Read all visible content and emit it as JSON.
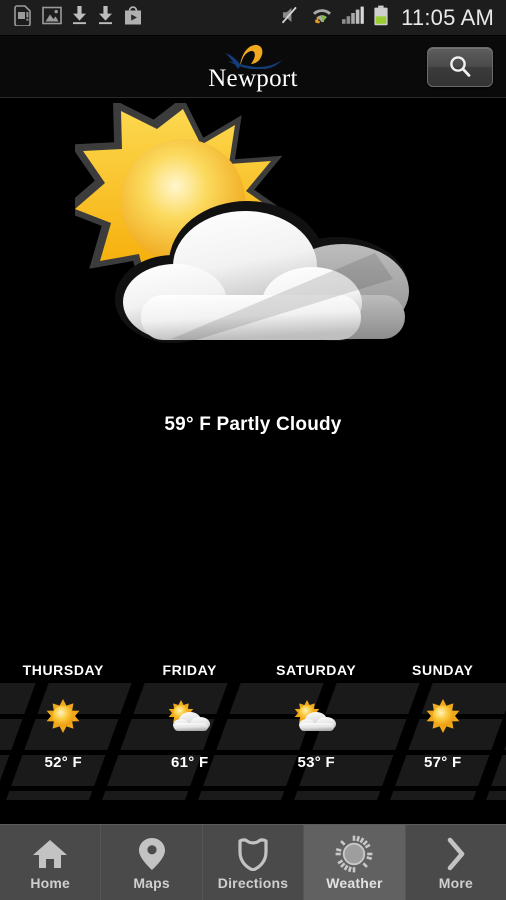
{
  "statusbar": {
    "time": "11:05 AM",
    "left_icons": [
      {
        "name": "sim-card-alert-icon",
        "label": "SIM card alert"
      },
      {
        "name": "image-icon",
        "label": "Screenshot captured"
      },
      {
        "name": "download-icon",
        "label": "Download complete"
      },
      {
        "name": "download-icon-2",
        "label": "Download complete"
      },
      {
        "name": "play-store-icon",
        "label": "Play Store"
      }
    ],
    "right_icons": [
      {
        "name": "volume-mute-icon",
        "label": "Sound muted"
      },
      {
        "name": "wifi-icon",
        "label": "Wi-Fi connected"
      },
      {
        "name": "signal-bars-icon",
        "label": "Cellular signal"
      },
      {
        "name": "battery-icon",
        "label": "Battery"
      }
    ]
  },
  "header": {
    "logo_text": "Newport",
    "logo_swoosh_gold": "#F0A81E",
    "logo_swoosh_blue": "#133D77",
    "search_label": "Search"
  },
  "current": {
    "condition_line": "59° F Partly Cloudy",
    "temperature": "59° F",
    "condition": "Partly Cloudy",
    "icon": "partly-cloudy-icon"
  },
  "forecast": [
    {
      "day": "THURSDAY",
      "icon": "sunny-icon",
      "temp": "52° F"
    },
    {
      "day": "FRIDAY",
      "icon": "partly-cloudy-icon",
      "temp": "61° F"
    },
    {
      "day": "SATURDAY",
      "icon": "partly-cloudy-icon",
      "temp": "53° F"
    },
    {
      "day": "SUNDAY",
      "icon": "sunny-icon",
      "temp": "57° F"
    }
  ],
  "nav": {
    "active": "Weather",
    "items": [
      {
        "label": "Home",
        "icon": "home-icon"
      },
      {
        "label": "Maps",
        "icon": "map-pin-icon"
      },
      {
        "label": "Directions",
        "icon": "shield-sign-icon"
      },
      {
        "label": "Weather",
        "icon": "sun-icon"
      },
      {
        "label": "More",
        "icon": "chevron-right-icon"
      }
    ]
  },
  "colors": {
    "background": "#000000",
    "statusbar_bg": "#1d1d1d",
    "navbar_bg": "#4a4a4a",
    "navbar_active_bg": "#616161",
    "sun_gold": "#F5C518",
    "battery_green": "#9ACD32"
  }
}
